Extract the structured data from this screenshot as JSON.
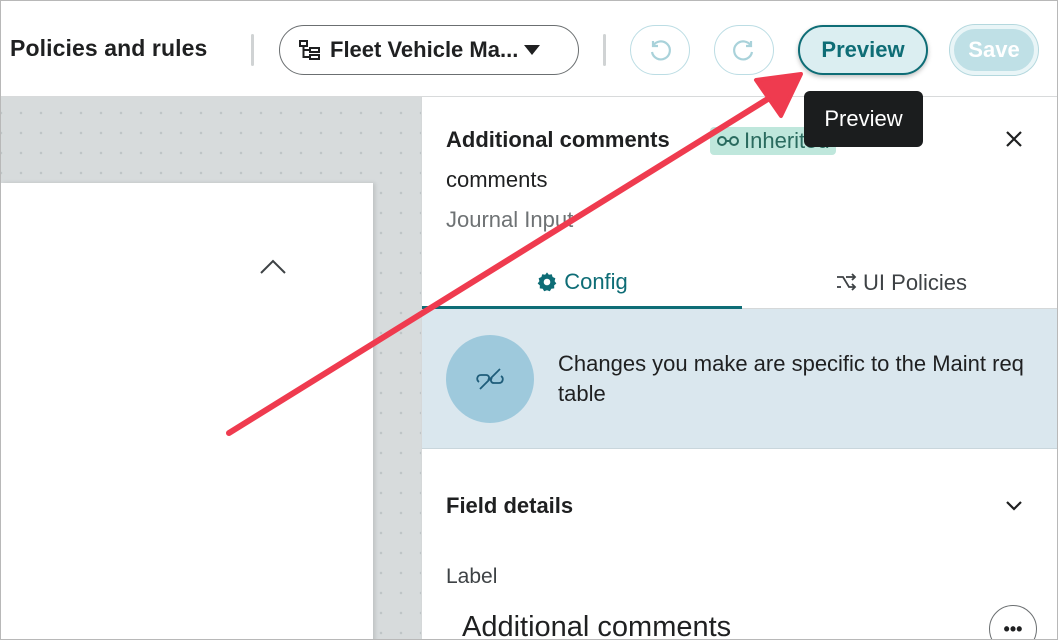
{
  "header": {
    "title": "Policies and rules",
    "scope_label": "Fleet Vehicle Ma...",
    "undo_icon": "undo-icon",
    "redo_icon": "redo-icon",
    "preview_label": "Preview",
    "save_label": "Save"
  },
  "tooltip": {
    "text": "Preview"
  },
  "panel": {
    "title": "Additional comments",
    "badge": "Inherited",
    "field_name": "comments",
    "field_type": "Journal Input",
    "tabs": [
      {
        "label": "Config",
        "icon": "gear-icon",
        "active": true
      },
      {
        "label": "UI Policies",
        "icon": "ui-policy-icon",
        "active": false
      }
    ],
    "banner_text": "Changes you make are specific to the Maint req table",
    "section_title": "Field details",
    "label_caption": "Label",
    "label_value": "Additional comments",
    "more_label": "•••"
  },
  "colors": {
    "accent": "#0e6d76",
    "banner_bg": "#dae7ee",
    "badge_bg": "#bfe7dc",
    "annotation_arrow": "#ef3b4f"
  }
}
